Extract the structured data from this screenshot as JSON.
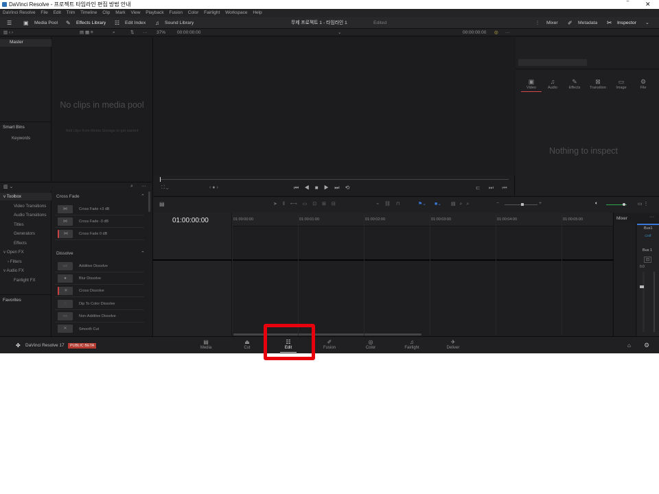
{
  "window": {
    "title": "DaVinci Resolve - 프로젝트 타임라인 편집 방법 안내"
  },
  "menu": [
    "DaVinci Resolve",
    "File",
    "Edit",
    "Trim",
    "Timeline",
    "Clip",
    "Mark",
    "View",
    "Playback",
    "Fusion",
    "Color",
    "Fairlight",
    "Workspace",
    "Help"
  ],
  "toolbar": {
    "media_pool": "Media Pool",
    "effects_library": "Effects Library",
    "edit_index": "Edit Index",
    "sound_library": "Sound Library",
    "project_title": "무제 프로젝트 1 - 타임라인 1",
    "edited": "Edited",
    "mixer": "Mixer",
    "metadata": "Metadata",
    "inspector": "Inspector"
  },
  "viewer": {
    "zoom": "37%",
    "source_tc": "00:00:00:00",
    "record_tc": "00:00:00:00"
  },
  "media_pool": {
    "bin": "Master",
    "empty": "No clips in media pool",
    "hint": "Add clips from Media Storage to get started",
    "smart_bins": "Smart Bins",
    "keywords": "Keywords"
  },
  "toolbox_tree": [
    {
      "label": "Toolbox",
      "level": 0,
      "arrow": "v"
    },
    {
      "label": "Video Transitions",
      "level": 1
    },
    {
      "label": "Audio Transitions",
      "level": 1
    },
    {
      "label": "Titles",
      "level": 1
    },
    {
      "label": "Generators",
      "level": 1
    },
    {
      "label": "Effects",
      "level": 1
    },
    {
      "label": "Open FX",
      "level": 0,
      "arrow": "v"
    },
    {
      "label": "Filters",
      "level": 1,
      "arrow": ">"
    },
    {
      "label": "Audio FX",
      "level": 0,
      "arrow": "v"
    },
    {
      "label": "Fairlight FX",
      "level": 1
    }
  ],
  "favorites": "Favorites",
  "effects": {
    "cross_fade_header": "Cross Fade",
    "cross_fade": [
      "Cross Fade +3 dB",
      "Cross Fade -3 dB",
      "Cross Fade 0 dB"
    ],
    "dissolve_header": "Dissolve",
    "dissolve": [
      "Additive Dissolve",
      "Blur Dissolve",
      "Cross Dissolve",
      "Dip To Color Dissolve",
      "Non-Additive Dissolve",
      "Smooth Cut"
    ]
  },
  "inspector": {
    "tabs": [
      "Video",
      "Audio",
      "Effects",
      "Transition",
      "Image",
      "File"
    ],
    "empty": "Nothing to inspect"
  },
  "timeline": {
    "timecode": "01:00:00:00",
    "ruler": [
      "01:00:00:00",
      "01:00:01:00",
      "01:00:02:00",
      "01:00:03:00",
      "01:00:04:00",
      "01:00:05:00"
    ]
  },
  "mixer": {
    "title": "Mixer",
    "bus": "Bus1",
    "bus_label": "Bus 1",
    "meter_top": "0.0"
  },
  "status": {
    "app": "DaVinci Resolve 17",
    "badge": "PUBLIC BETA"
  },
  "pages": [
    "Media",
    "Cut",
    "Edit",
    "Fusion",
    "Color",
    "Fairlight",
    "Deliver"
  ],
  "active_page": "Edit",
  "highlight_color": "#e8000d"
}
